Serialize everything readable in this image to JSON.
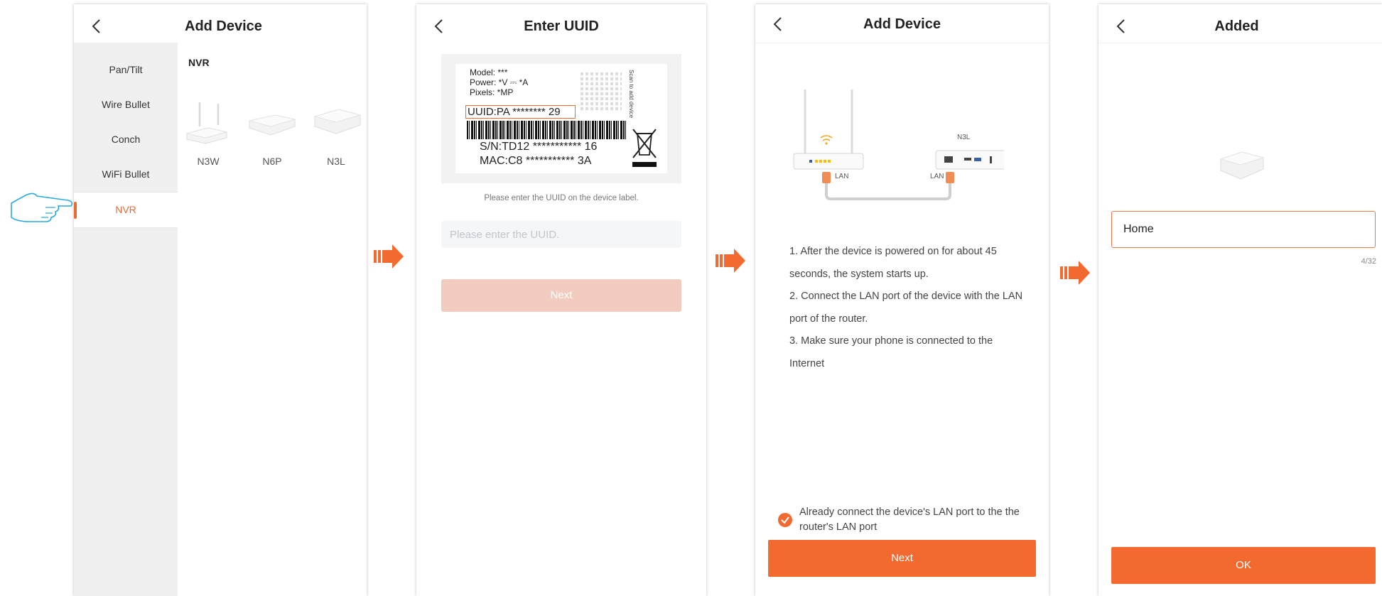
{
  "colors": {
    "accent": "#f26a2f",
    "accent_disabled": "#f2cdbf",
    "hand_outline": "#29aae1"
  },
  "screen1": {
    "title": "Add Device",
    "sidebar": [
      "Pan/Tilt",
      "Wire Bullet",
      "Conch",
      "WiFi Bullet",
      "NVR"
    ],
    "active_item": "NVR",
    "category": "NVR",
    "products": [
      "N3W",
      "N6P",
      "N3L"
    ]
  },
  "screen2": {
    "title": "Enter UUID",
    "label": {
      "model": "Model: ***",
      "power": "Power: *V ⎓ *A",
      "pixels": "Pixels: *MP",
      "uuid": "UUID:PA ******** 29",
      "sn": "S/N:TD12 *********** 16",
      "mac": "MAC:C8 *********** 3A",
      "scan": "Scan to add device"
    },
    "hint": "Please enter the UUID on the device label.",
    "placeholder": "Please enter the UUID.",
    "next": "Next"
  },
  "screen3": {
    "title": "Add Device",
    "diagram": {
      "device_name": "N3L",
      "lan_left": "LAN",
      "lan_right": "LAN"
    },
    "steps": [
      "1. After the device is powered on for about 45 seconds, the system starts up.",
      "2. Connect the LAN port of the device with the LAN port of the router.",
      "3. Make sure your phone is connected to the Internet"
    ],
    "checkbox": "Already connect the device's LAN port to the the router's LAN port",
    "next": "Next"
  },
  "screen4": {
    "title": "Added",
    "name_value": "Home",
    "counter": "4/32",
    "ok": "OK"
  }
}
